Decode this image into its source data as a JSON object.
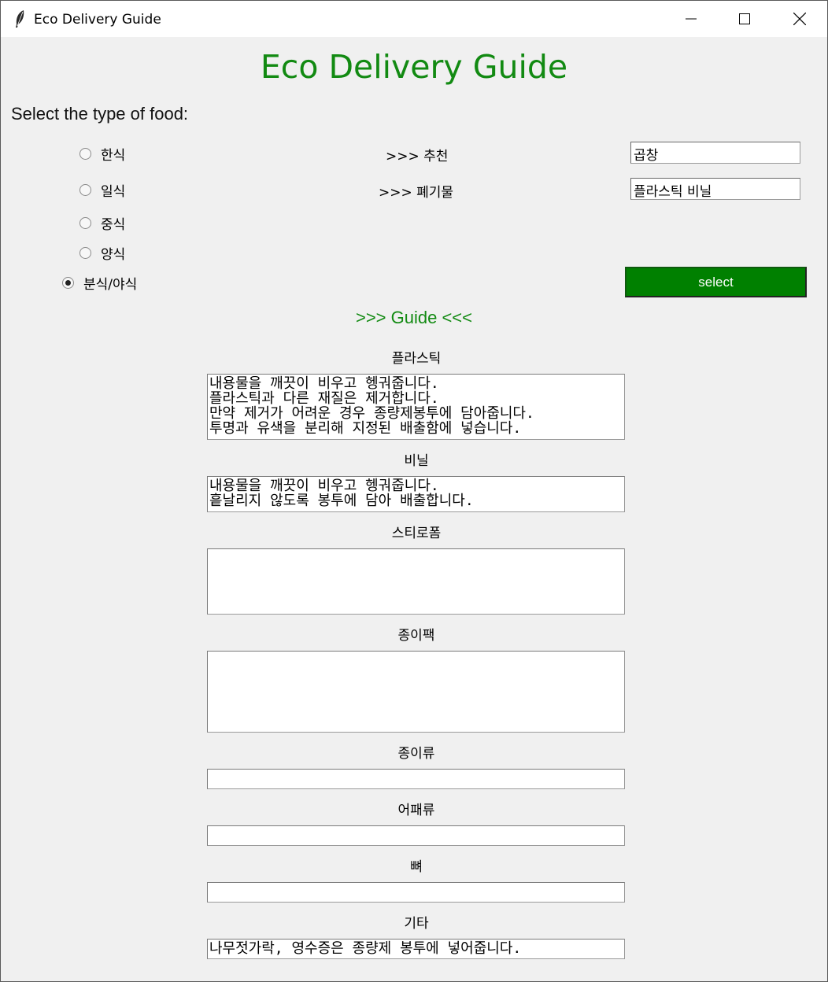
{
  "window": {
    "title": "Eco Delivery Guide"
  },
  "header": {
    "title": "Eco Delivery Guide",
    "prompt": "Select the type of food:"
  },
  "food_types": {
    "selected": "분식/야식",
    "options": [
      {
        "label": "한식",
        "checked": false
      },
      {
        "label": "일식",
        "checked": false
      },
      {
        "label": "중식",
        "checked": false
      },
      {
        "label": "양식",
        "checked": false
      },
      {
        "label": "분식/야식",
        "checked": true
      }
    ]
  },
  "recommendation": {
    "label": ">>> 추천",
    "value": "곱창"
  },
  "waste": {
    "label": ">>> 폐기물",
    "value": "플라스틱 비닐"
  },
  "select_button": {
    "label": "select"
  },
  "guide": {
    "title": ">>> Guide <<<",
    "sections": [
      {
        "label": "플라스틱",
        "text": "내용물을 깨끗이 비우고 헹궈줍니다.\n플라스틱과 다른 재질은 제거합니다.\n만약 제거가 어려운 경우 종량제봉투에 담아줍니다.\n투명과 유색을 분리해 지정된 배출함에 넣습니다."
      },
      {
        "label": "비닐",
        "text": "내용물을 깨끗이 비우고 헹궈줍니다.\n흩날리지 않도록 봉투에 담아 배출합니다."
      },
      {
        "label": "스티로폼",
        "text": ""
      },
      {
        "label": "종이팩",
        "text": ""
      },
      {
        "label": "종이류",
        "text": ""
      },
      {
        "label": "어패류",
        "text": ""
      },
      {
        "label": "뼈",
        "text": ""
      },
      {
        "label": "기타",
        "text": "나무젓가락, 영수증은 종량제 봉투에 넣어줍니다."
      }
    ]
  },
  "colors": {
    "accent_green": "#128a12",
    "button_green": "#008000"
  }
}
